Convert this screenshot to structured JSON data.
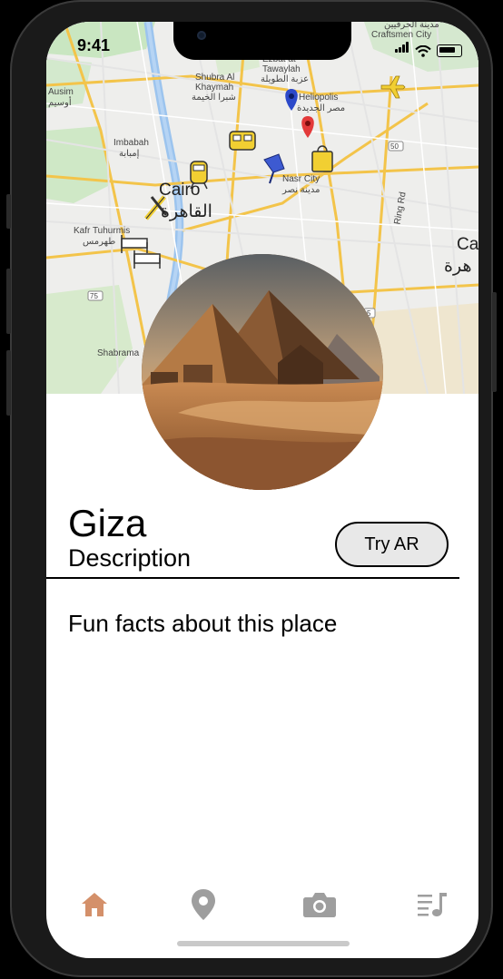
{
  "status_bar": {
    "time": "9:41"
  },
  "map": {
    "labels": {
      "ausim": "Ausim",
      "ausim_ar": "أوسيم",
      "shubra": "Shubra Al",
      "khaymah": "Khaymah",
      "shubra_ar": "شبرا الخيمة",
      "ezbat": "Ezbat at",
      "tawaylah": "Tawaylah",
      "tawaylah_ar": "عزبة الطويلة",
      "heliopolis": "Heliopolis",
      "heliopolis_ar": "مصر الجديدة",
      "craftsmen_ar": "مدينة الحرفيين",
      "craftsmen": "Craftsmen City",
      "imbabah": "Imbabah",
      "imbabah_ar": "إمبابة",
      "cairo": "Cairo",
      "cairo_ar": "القاهرة",
      "nasr": "Nasr City",
      "nasr_ar": "مدينة نصر",
      "kafr": "Kafr Tuhurmis",
      "kafr_ar": "طهرمس",
      "ring": "Ring Rd",
      "shabrama": "Shabrama",
      "ca_partial": "Ca",
      "ca_ar_partial": "هرة",
      "road50": "50",
      "road75": "75",
      "road5": "5"
    }
  },
  "place": {
    "title": "Giza",
    "subtitle": "Description",
    "try_ar_label": "Try AR",
    "fun_facts": "Fun facts about this place"
  },
  "tabbar": {
    "active_color": "#d4906a",
    "inactive_color": "#9e9e9e",
    "tabs": [
      "home-icon",
      "location-pin-icon",
      "camera-icon",
      "playlist-icon"
    ]
  }
}
